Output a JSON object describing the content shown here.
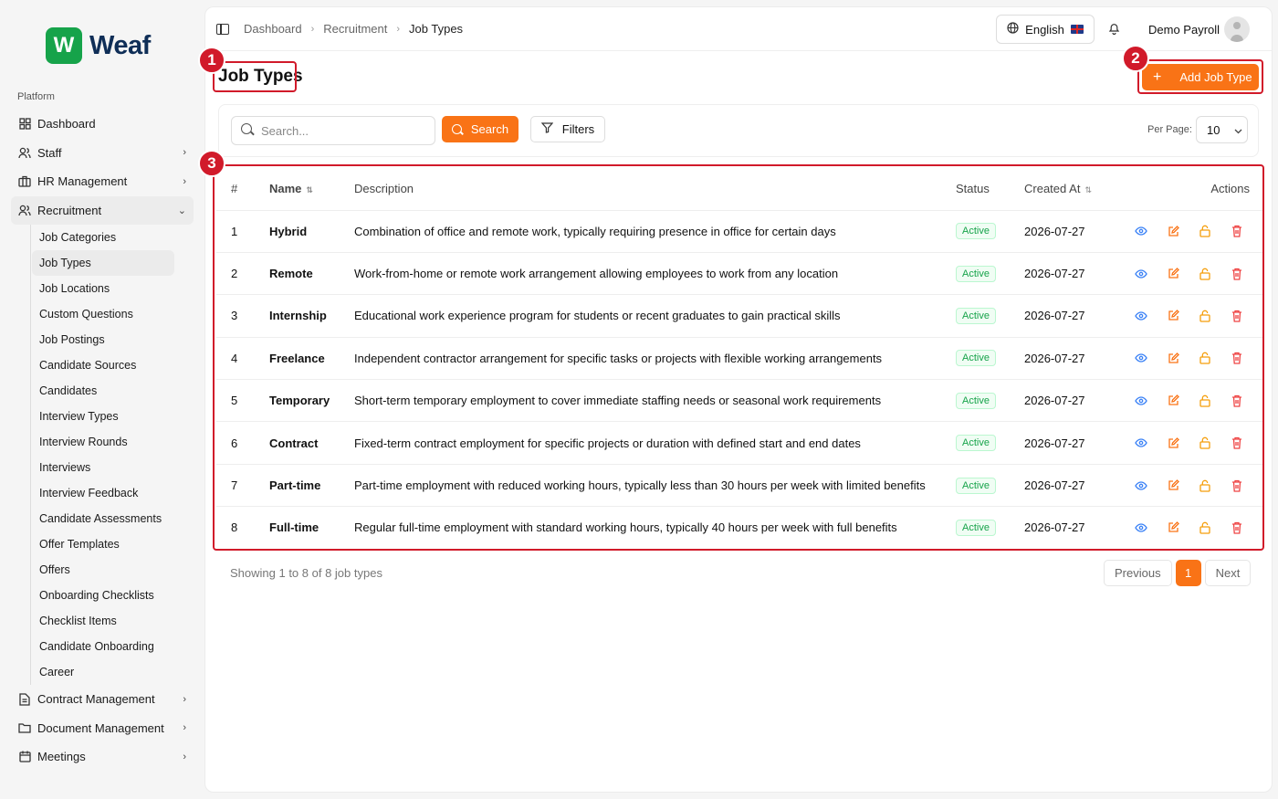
{
  "app": {
    "logo_letter": "W",
    "logo_text": "Weaf"
  },
  "sidebar": {
    "section_label": "Platform",
    "items": [
      {
        "label": "Dashboard",
        "icon": "grid-icon"
      },
      {
        "label": "Staff",
        "icon": "users-icon"
      },
      {
        "label": "HR Management",
        "icon": "briefcase-icon"
      },
      {
        "label": "Recruitment",
        "icon": "user-icon"
      }
    ],
    "recruitment_sub": [
      "Job Categories",
      "Job Types",
      "Job Locations",
      "Custom Questions",
      "Job Postings",
      "Candidate Sources",
      "Candidates",
      "Interview Types",
      "Interview Rounds",
      "Interviews",
      "Interview Feedback",
      "Candidate Assessments",
      "Offer Templates",
      "Offers",
      "Onboarding Checklists",
      "Checklist Items",
      "Candidate Onboarding",
      "Career"
    ],
    "bottom_items": [
      {
        "label": "Contract Management",
        "icon": "file-icon"
      },
      {
        "label": "Document Management",
        "icon": "folder-icon"
      },
      {
        "label": "Meetings",
        "icon": "calendar-icon"
      }
    ]
  },
  "breadcrumb": [
    "Dashboard",
    "Recruitment",
    "Job Types"
  ],
  "header": {
    "language": "English",
    "user_name": "Demo Payroll"
  },
  "page": {
    "title": "Job Types",
    "add_label": "Add Job Type"
  },
  "filters": {
    "search_placeholder": "Search...",
    "search_label": "Search",
    "filters_label": "Filters",
    "per_page_label": "Per Page:",
    "per_page_value": "10"
  },
  "table": {
    "columns": [
      "#",
      "Name",
      "Description",
      "Status",
      "Created At",
      "Actions"
    ],
    "rows": [
      {
        "num": "1",
        "name": "Hybrid",
        "desc": "Combination of office and remote work, typically requiring presence in office for certain days",
        "status": "Active",
        "date": "2026-07-27"
      },
      {
        "num": "2",
        "name": "Remote",
        "desc": "Work-from-home or remote work arrangement allowing employees to work from any location",
        "status": "Active",
        "date": "2026-07-27"
      },
      {
        "num": "3",
        "name": "Internship",
        "desc": "Educational work experience program for students or recent graduates to gain practical skills",
        "status": "Active",
        "date": "2026-07-27"
      },
      {
        "num": "4",
        "name": "Freelance",
        "desc": "Independent contractor arrangement for specific tasks or projects with flexible working arrangements",
        "status": "Active",
        "date": "2026-07-27"
      },
      {
        "num": "5",
        "name": "Temporary",
        "desc": "Short-term temporary employment to cover immediate staffing needs or seasonal work requirements",
        "status": "Active",
        "date": "2026-07-27"
      },
      {
        "num": "6",
        "name": "Contract",
        "desc": "Fixed-term contract employment for specific projects or duration with defined start and end dates",
        "status": "Active",
        "date": "2026-07-27"
      },
      {
        "num": "7",
        "name": "Part-time",
        "desc": "Part-time employment with reduced working hours, typically less than 30 hours per week with limited benefits",
        "status": "Active",
        "date": "2026-07-27"
      },
      {
        "num": "8",
        "name": "Full-time",
        "desc": "Regular full-time employment with standard working hours, typically 40 hours per week with full benefits",
        "status": "Active",
        "date": "2026-07-27"
      }
    ]
  },
  "footer": {
    "showing": "Showing 1 to 8 of 8 job types",
    "previous": "Previous",
    "current_page": "1",
    "next": "Next"
  },
  "annotations": [
    "1",
    "2",
    "3"
  ],
  "colors": {
    "accent": "#f97316",
    "annotation": "#d11a2a",
    "brand": "#16a34a"
  }
}
